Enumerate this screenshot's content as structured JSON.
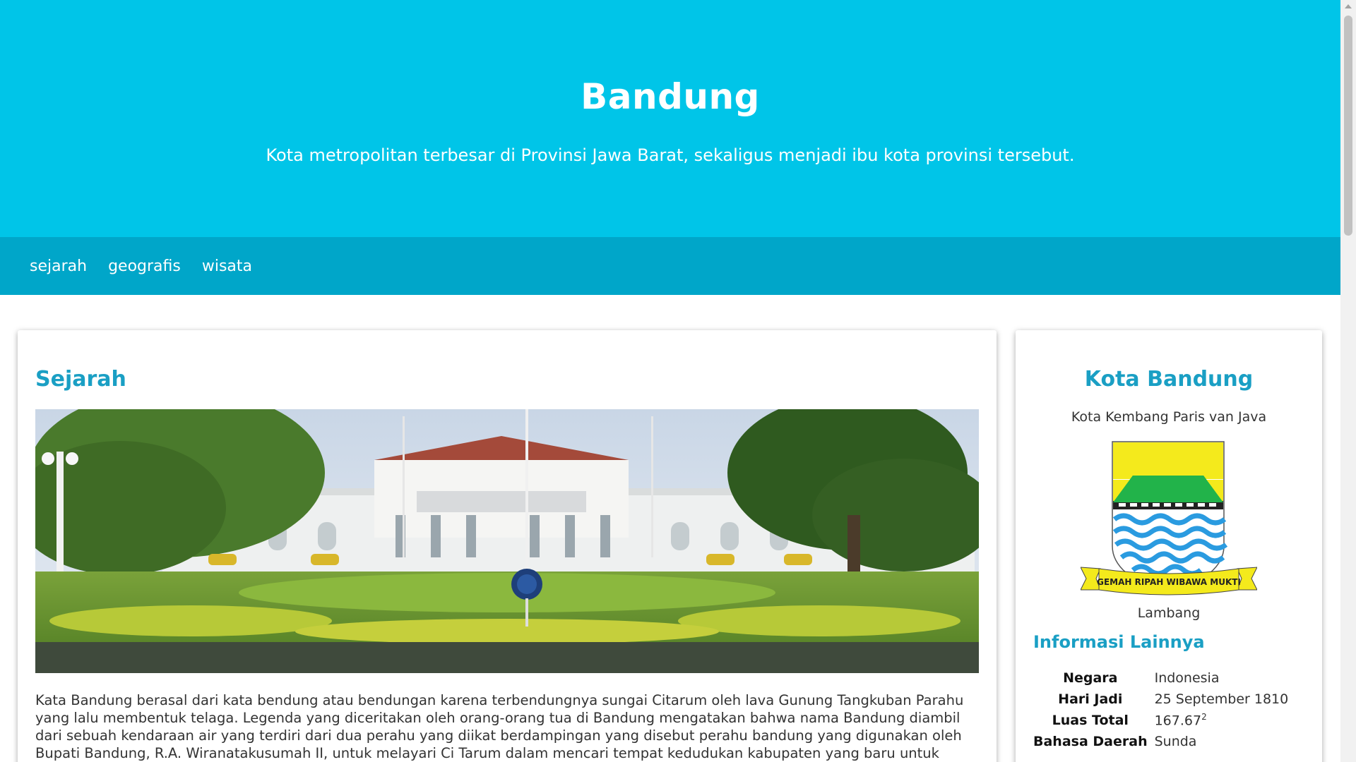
{
  "header": {
    "title": "Bandung",
    "tagline": "Kota metropolitan terbesar di Provinsi Jawa Barat, sekaligus menjadi ibu kota provinsi tersebut."
  },
  "nav": {
    "items": [
      {
        "label": "sejarah"
      },
      {
        "label": "geografis"
      },
      {
        "label": "wisata"
      }
    ]
  },
  "main": {
    "section_title": "Sejarah",
    "paragraph": "Kata Bandung berasal dari kata bendung atau bendungan karena terbendungnya sungai Citarum oleh lava Gunung Tangkuban Parahu yang lalu membentuk telaga. Legenda yang diceritakan oleh orang-orang tua di Bandung mengatakan bahwa nama Bandung diambil dari sebuah kendaraan air yang terdiri dari dua perahu yang diikat berdampingan yang disebut perahu bandung yang digunakan oleh Bupati Bandung, R.A. Wiranatakusumah II, untuk melayari Ci Tarum dalam mencari tempat kedudukan kabupaten yang baru untuk menggantikan ibu kota yang"
  },
  "sidebar": {
    "title": "Kota Bandung",
    "subtitle": "Kota Kembang Paris van Java",
    "emblem_motto": "GEMAH RIPAH WIBAWA MUKTI",
    "emblem_caption": "Lambang",
    "info_title": "Informasi Lainnya",
    "info": [
      {
        "key": "Negara",
        "value": "Indonesia"
      },
      {
        "key": "Hari Jadi",
        "value": "25 September 1810"
      },
      {
        "key": "Luas Total",
        "value": "167.67",
        "superscript": "2"
      },
      {
        "key": "Bahasa Daerah",
        "value": "Sunda"
      }
    ]
  },
  "colors": {
    "header_bg": "#00c5e8",
    "nav_bg": "#00a6c9",
    "accent": "#1a9fc4"
  }
}
